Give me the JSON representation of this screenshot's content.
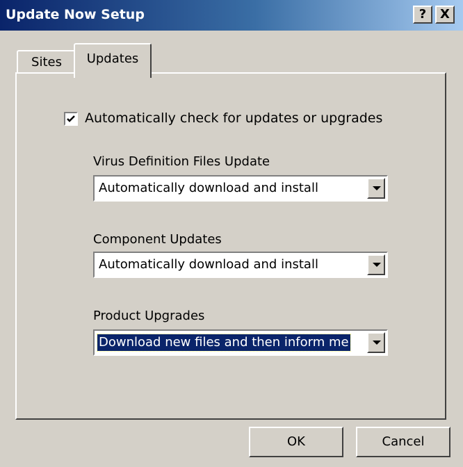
{
  "window": {
    "title": "Update Now Setup",
    "help_glyph": "?",
    "close_glyph": "X"
  },
  "tabs": [
    {
      "label": "Sites",
      "active": false
    },
    {
      "label": "Updates",
      "active": true
    }
  ],
  "auto_check": {
    "label": "Automatically check for updates or upgrades",
    "checked": true
  },
  "fields": [
    {
      "label": "Virus Definition Files Update",
      "value": "Automatically download and install"
    },
    {
      "label": "Component Updates",
      "value": "Automatically download and install"
    },
    {
      "label": "Product Upgrades",
      "value": "Download new files and then inform me"
    }
  ],
  "buttons": {
    "ok": "OK",
    "cancel": "Cancel"
  },
  "icons": {
    "help": "help-icon",
    "close": "close-icon",
    "check": "checkmark-icon",
    "dropdown": "chevron-down-icon"
  }
}
